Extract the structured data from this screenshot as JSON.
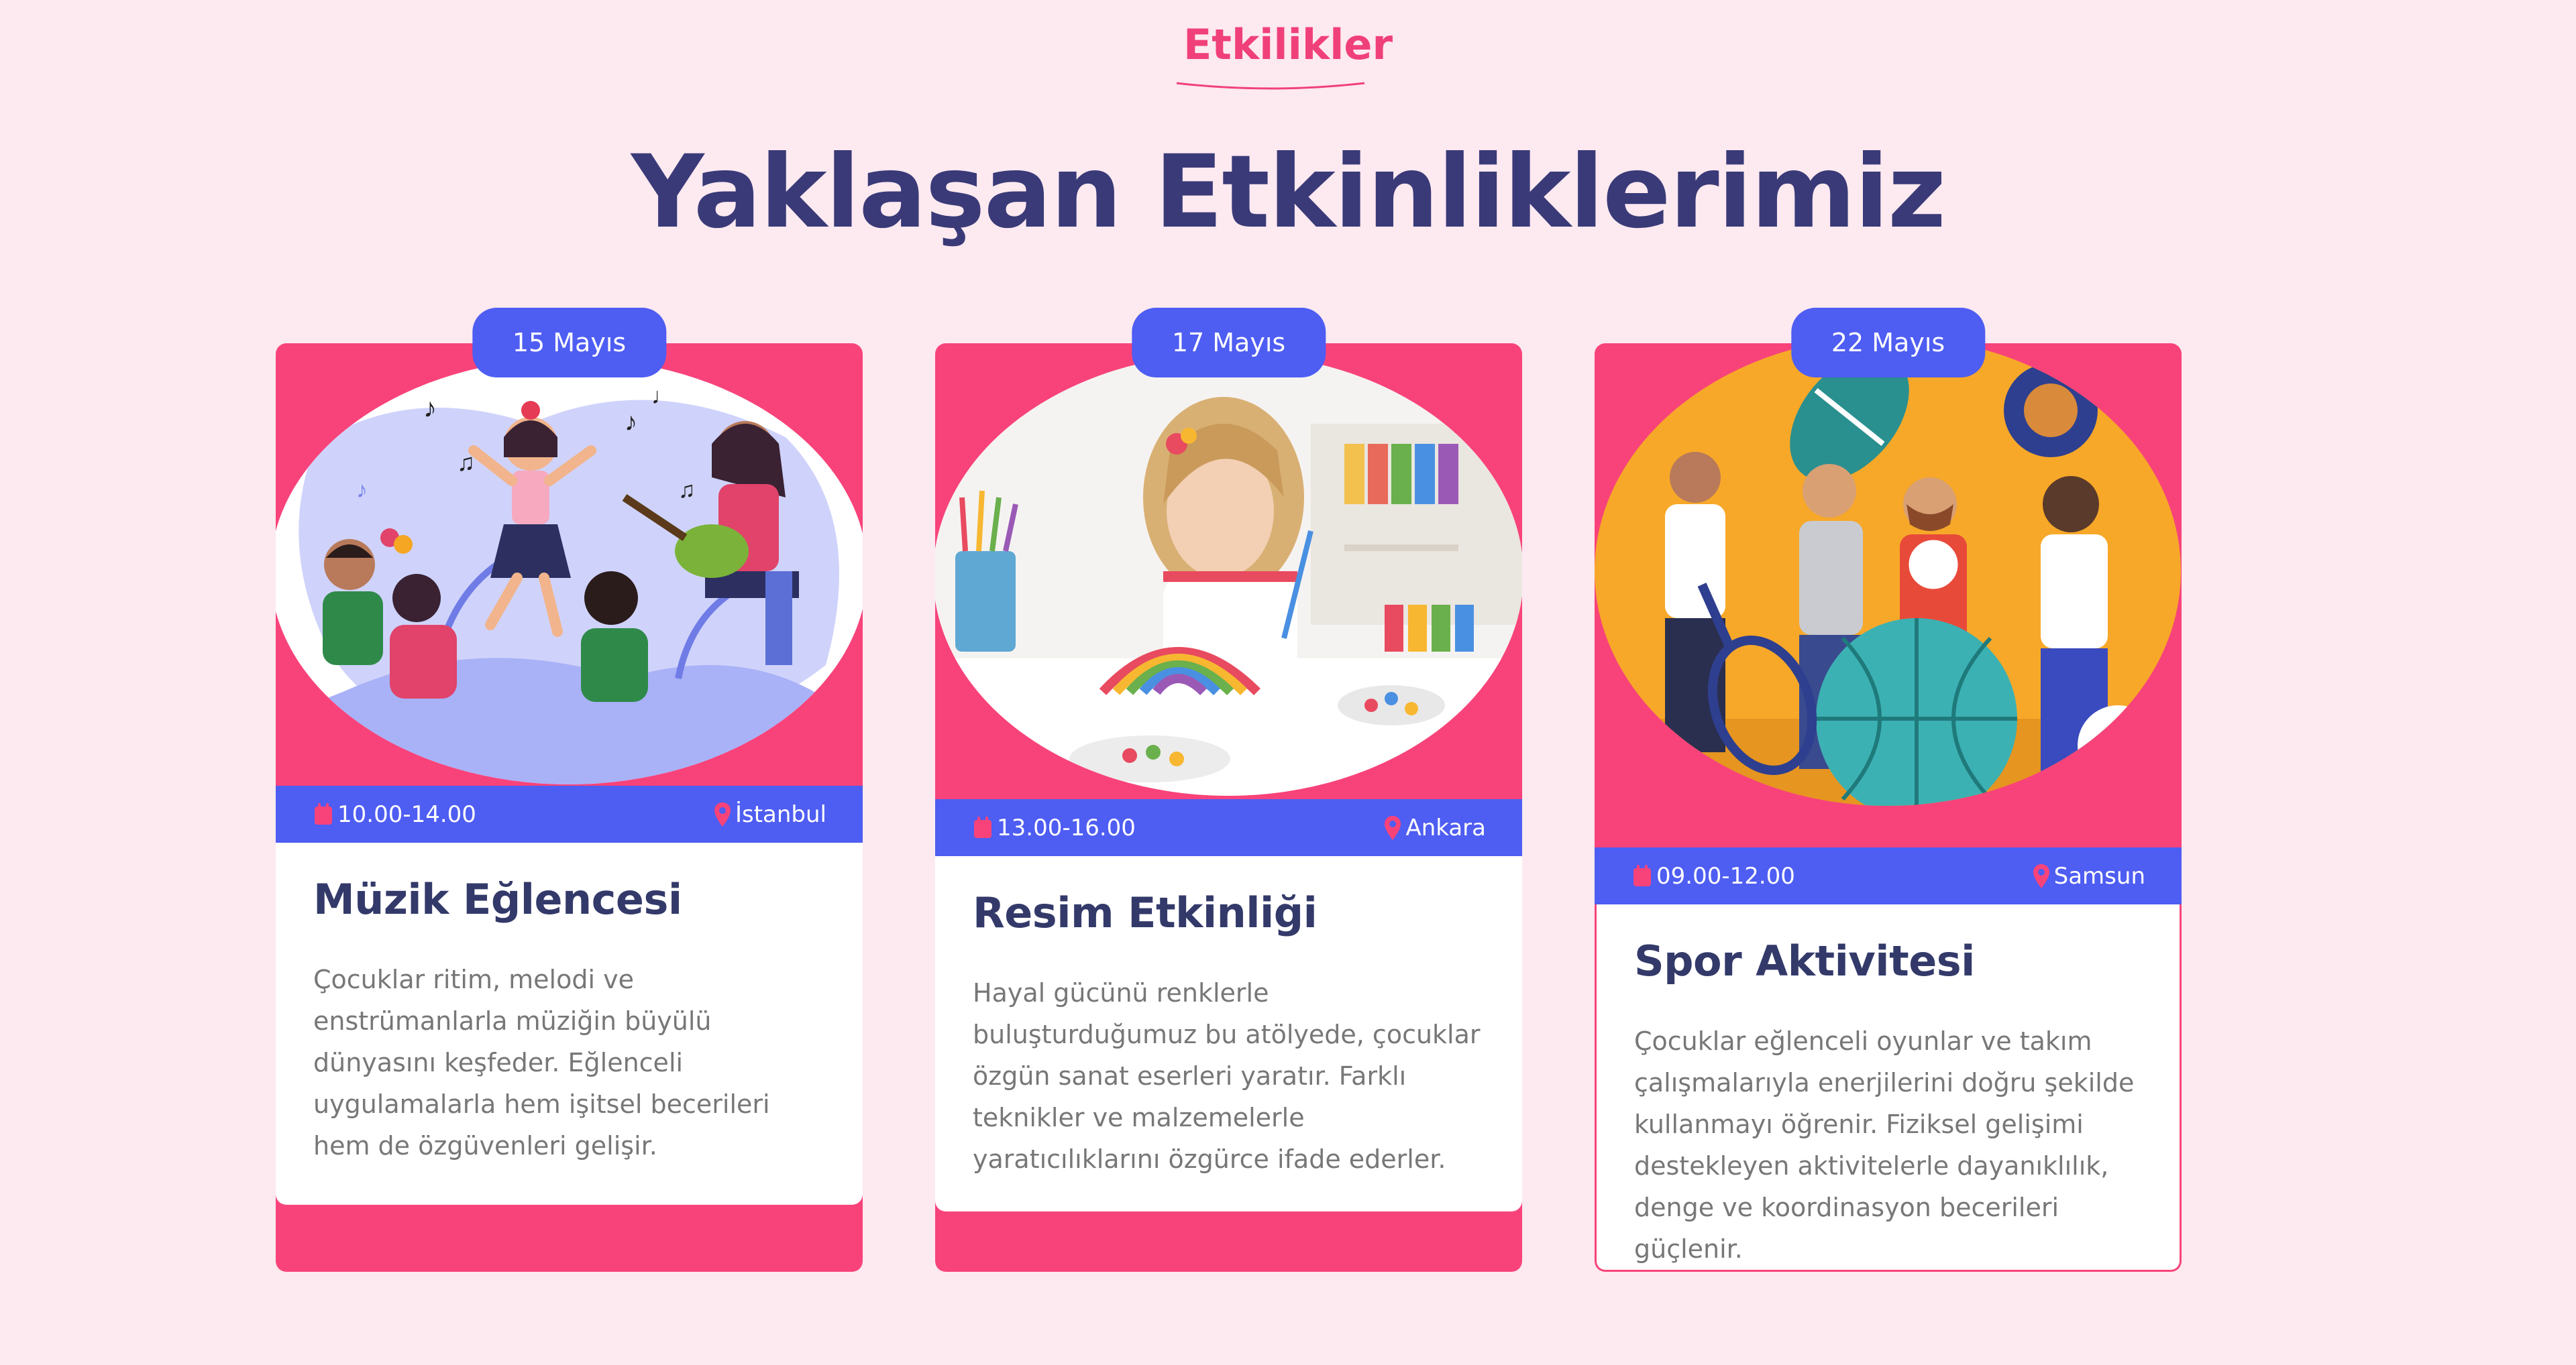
{
  "section": {
    "eyebrow": "Etkilikler",
    "title": "Yaklaşan Etkinliklerimiz"
  },
  "colors": {
    "background": "#fde9f0",
    "accent_pink": "#f8437a",
    "accent_blue": "#4e5df2",
    "title_navy": "#3a3a78"
  },
  "events": [
    {
      "date": "15 Mayıs",
      "time": "10.00-14.00",
      "location": "İstanbul",
      "title": "Müzik Eğlencesi",
      "description": "Çocuklar ritim, melodi ve enstrümanlarla müziğin büyülü dünyasını keşfeder. Eğlenceli uygulamalarla hem işitsel becerileri hem de özgüvenleri gelişir.",
      "image_icon": "music-illustration"
    },
    {
      "date": "17 Mayıs",
      "time": "13.00-16.00",
      "location": "Ankara",
      "title": "Resim Etkinliği",
      "description": "Hayal gücünü renklerle buluşturduğumuz bu atölyede, çocuklar özgün sanat eserleri yaratır. Farklı teknikler ve malzemelerle yaratıcılıklarını özgürce ifade ederler.",
      "image_icon": "painting-photo"
    },
    {
      "date": "22 Mayıs",
      "time": "09.00-12.00",
      "location": "Samsun",
      "title": "Spor Aktivitesi",
      "description": "Çocuklar eğlenceli oyunlar ve takım çalışmalarıyla enerjilerini doğru şekilde kullanmayı öğrenir. Fiziksel gelişimi destekleyen aktivitelerle dayanıklılık, denge ve koordinasyon becerileri güçlenir.",
      "image_icon": "sports-illustration"
    }
  ]
}
